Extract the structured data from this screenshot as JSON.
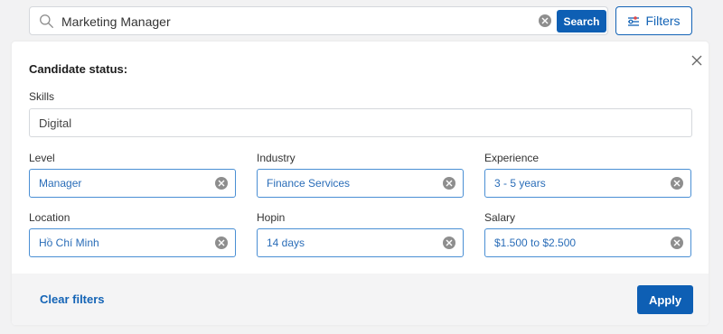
{
  "search": {
    "value": "Marketing Manager",
    "icon": "search-icon",
    "clear_icon": "clear-icon",
    "button_label": "Search"
  },
  "filters_button": {
    "label": "Filters",
    "icon": "filters-icon",
    "accent_color": "#1363b6"
  },
  "panel": {
    "title": "Candidate status:",
    "close_icon": "close-icon",
    "skills": {
      "label": "Skills",
      "value": "Digital"
    },
    "level": {
      "label": "Level",
      "value": "Manager"
    },
    "industry": {
      "label": "Industry",
      "value": "Finance Services"
    },
    "experience": {
      "label": "Experience",
      "value": "3 - 5 years"
    },
    "location": {
      "label": "Location",
      "value": "Hồ Chí Minh"
    },
    "hopin": {
      "label": "Hopin",
      "value": "14 days"
    },
    "salary": {
      "label": "Salary",
      "value": "$1.500 to $2.500"
    }
  },
  "footer": {
    "clear_label": "Clear filters",
    "apply_label": "Apply"
  },
  "colors": {
    "primary": "#0e5fb4",
    "select_border": "#4a8fd4",
    "select_text": "#2a6db8",
    "background": "#f2f2f3"
  }
}
